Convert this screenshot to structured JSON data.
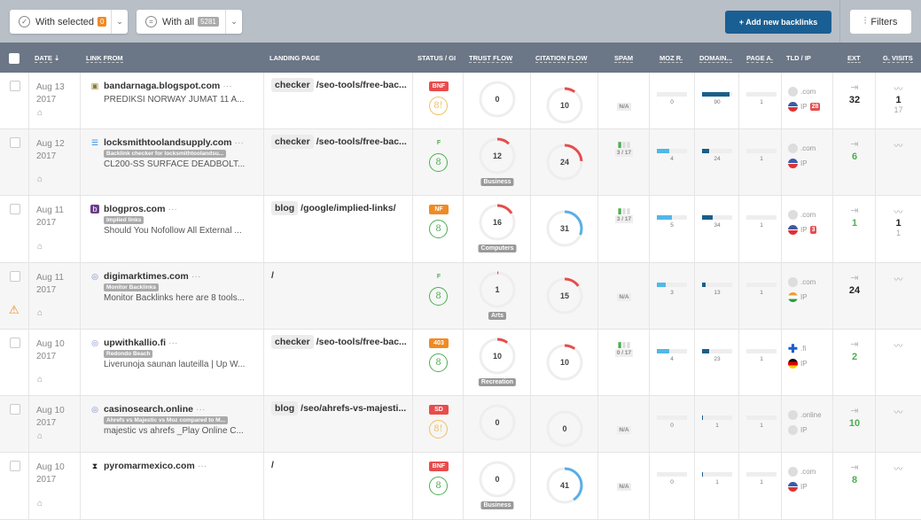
{
  "toolbar": {
    "with_selected": "With selected",
    "selected_count": "0",
    "with_all": "With all",
    "all_count": "5281",
    "add_backlinks": "+ Add new backlinks",
    "filters": "Filters"
  },
  "colors": {
    "brand": "#1a5f93",
    "header": "#6b7686",
    "red": "#e84c4c",
    "orange": "#f08a24",
    "green": "#4caf50",
    "moz_bar": "#4fb8e8",
    "domain_bar": "#1a5f8a",
    "cf_blue": "#5aaee8"
  },
  "columns": [
    "DATE",
    "LINK FROM",
    "LANDING PAGE",
    "STATUS / GI",
    "TRUST FLOW",
    "CITATION FLOW",
    "SPAM",
    "MOZ R.",
    "DOMAIN...",
    "PAGE A.",
    "TLD / IP",
    "EXT",
    "G. VISITS"
  ],
  "rows": [
    {
      "date": "Aug 13",
      "year": "2017",
      "favicon": "blogger-icon",
      "domain": "bandarnaga.blogspot.com",
      "tag": "",
      "desc": "PREDIKSI NORWAY JUMAT 11 A...",
      "lp_tag": "checker",
      "lp_path": "/seo-tools/free-bac...",
      "status": "BNF",
      "status_color": "#e84c4c",
      "google": "8!",
      "google_color": "#f0c060",
      "tf": 0,
      "tf_cat": "",
      "cf": 10,
      "cf_color": "#e84c4c",
      "spam": "N/A",
      "spam_bars": 0,
      "moz": 0,
      "domain_auth": 90,
      "page_auth": 1,
      "tld": ".com",
      "ip_flag": "us",
      "ip_badge": "28",
      "ext": "32",
      "ext_color": "#222",
      "visits": "1",
      "visits_sub": "17"
    },
    {
      "date": "Aug 12",
      "year": "2017",
      "favicon": "menu-icon",
      "domain": "locksmithtoolandsupply.com",
      "tag": "Backlink checker for locksmithtoolandsu...",
      "desc": "CL200-SS SURFACE DEADBOLT...",
      "lp_tag": "checker",
      "lp_path": "/seo-tools/free-bac...",
      "status": "F",
      "status_color": "#4caf50",
      "google": "8",
      "google_color": "#4caf50",
      "tf": 12,
      "tf_cat": "Business",
      "cf": 24,
      "cf_color": "#e84c4c",
      "spam": "3 / 17",
      "spam_bars": 1,
      "moz": 4,
      "domain_auth": 24,
      "page_auth": 1,
      "tld": ".com",
      "ip_flag": "us",
      "ip_badge": "",
      "ext": "6",
      "ext_color": "#4caf50",
      "visits": "",
      "visits_sub": ""
    },
    {
      "date": "Aug 11",
      "year": "2017",
      "favicon": "blogpros-icon",
      "domain": "blogpros.com",
      "tag": "Implied links",
      "desc": "Should You Nofollow All External ...",
      "lp_tag": "blog",
      "lp_path": "/google/implied-links/",
      "status": "NF",
      "status_color": "#f08a24",
      "google": "8",
      "google_color": "#4caf50",
      "tf": 16,
      "tf_cat": "Computers",
      "cf": 31,
      "cf_color": "#5aaee8",
      "spam": "3 / 17",
      "spam_bars": 1,
      "moz": 5,
      "domain_auth": 34,
      "page_auth": 1,
      "tld": ".com",
      "ip_flag": "us",
      "ip_badge": "3",
      "ext": "1",
      "ext_color": "#4caf50",
      "visits": "1",
      "visits_sub": "1"
    },
    {
      "date": "Aug 11",
      "year": "2017",
      "favicon": "globe-icon",
      "warning": true,
      "domain": "digimarktimes.com",
      "tag": "Monitor Backlinks",
      "desc": "Monitor Backlinks here are 8 tools...",
      "lp_tag": "",
      "lp_path": "/",
      "status": "F",
      "status_color": "#4caf50",
      "google": "8",
      "google_color": "#4caf50",
      "tf": 1,
      "tf_cat": "Arts",
      "cf": 15,
      "cf_color": "#e84c4c",
      "spam": "N/A",
      "spam_bars": 0,
      "moz": 3,
      "domain_auth": 13,
      "page_auth": 1,
      "tld": ".com",
      "ip_flag": "in",
      "ip_badge": "",
      "ext": "24",
      "ext_color": "#222",
      "visits": "",
      "visits_sub": ""
    },
    {
      "date": "Aug 10",
      "year": "2017",
      "favicon": "globe-icon",
      "domain": "upwithkallio.fi",
      "tag": "Redondo Beach",
      "desc": "Liverunoja saunan lauteilla | Up W...",
      "lp_tag": "checker",
      "lp_path": "/seo-tools/free-bac...",
      "status": "403",
      "status_color": "#f08a24",
      "google": "8",
      "google_color": "#4caf50",
      "tf": 10,
      "tf_cat": "Recreation",
      "cf": 10,
      "cf_color": "#e84c4c",
      "spam": "0 / 17",
      "spam_bars": 1,
      "moz": 4,
      "domain_auth": 23,
      "page_auth": 1,
      "tld": ".fi",
      "tld_flag": "fi",
      "ip_flag": "de",
      "ip_badge": "",
      "ext": "2",
      "ext_color": "#4caf50",
      "visits": "",
      "visits_sub": ""
    },
    {
      "date": "Aug 10",
      "year": "2017",
      "favicon": "globe-icon",
      "domain": "casinosearch.online",
      "tag": "Ahrefs vs Majestic vs Moz compared to M...",
      "desc": "majestic vs ahrefs _Play Online C...",
      "lp_tag": "blog",
      "lp_path": "/seo/ahrefs-vs-majesti...",
      "status": "SD",
      "status_color": "#e84c4c",
      "google": "8!",
      "google_color": "#f0c060",
      "tf": 0,
      "tf_cat": "",
      "cf": 0,
      "cf_color": "#e84c4c",
      "spam": "N/A",
      "spam_bars": 0,
      "moz": 0,
      "domain_auth": 1,
      "page_auth": 1,
      "tld": ".online",
      "ip_flag": "globe",
      "ip_badge": "",
      "ext": "10",
      "ext_color": "#4caf50",
      "visits": "",
      "visits_sub": ""
    },
    {
      "date": "Aug 10",
      "year": "2017",
      "favicon": "hourglass-icon",
      "domain": "pyromarmexico.com",
      "tag": "",
      "desc": "",
      "lp_tag": "",
      "lp_path": "/",
      "status": "BNF",
      "status_color": "#e84c4c",
      "google": "8",
      "google_color": "#4caf50",
      "tf": 0,
      "tf_cat": "Business",
      "cf": 41,
      "cf_color": "#5aaee8",
      "spam": "N/A",
      "spam_bars": 0,
      "moz": 0,
      "domain_auth": 1,
      "page_auth": 1,
      "tld": ".com",
      "ip_flag": "us",
      "ip_badge": "",
      "ext": "8",
      "ext_color": "#4caf50",
      "visits": "",
      "visits_sub": ""
    }
  ]
}
